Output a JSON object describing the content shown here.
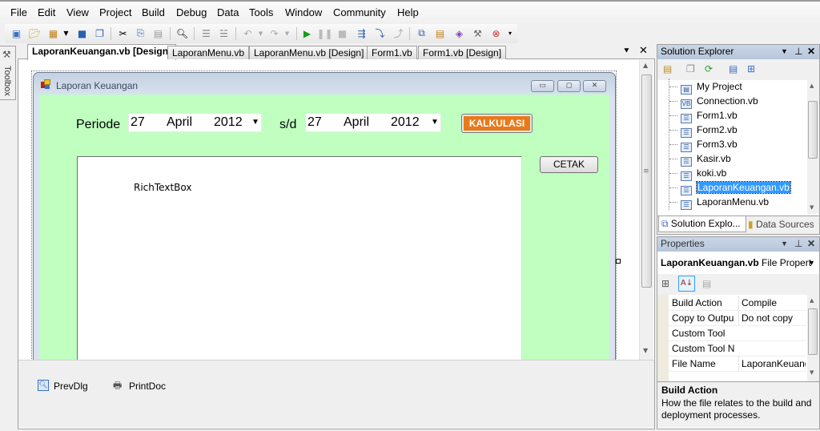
{
  "menu": [
    "File",
    "Edit",
    "View",
    "Project",
    "Build",
    "Debug",
    "Data",
    "Tools",
    "Window",
    "Community",
    "Help"
  ],
  "toolbar": {
    "icons": [
      "new-project-icon",
      "open-file-icon",
      "add-item-icon",
      "save-icon",
      "save-all-icon",
      "cut-icon",
      "copy-icon",
      "paste-icon",
      "find-icon",
      "comment-icon",
      "uncomment-icon",
      "undo-icon",
      "redo-icon",
      "start-debug-icon",
      "pause-icon",
      "stop-icon",
      "step-into-icon",
      "step-over-icon",
      "step-out-icon",
      "solution-explorer-icon",
      "properties-icon",
      "object-browser-icon",
      "toolbox-icon",
      "error-list-icon"
    ]
  },
  "toolbox": {
    "label": "Toolbox"
  },
  "tabs": [
    {
      "label": "LaporanKeuangan.vb [Design]",
      "active": true
    },
    {
      "label": "LaporanMenu.vb",
      "active": false
    },
    {
      "label": "LaporanMenu.vb [Design]",
      "active": false
    },
    {
      "label": "Form1.vb",
      "active": false
    },
    {
      "label": "Form1.vb [Design]",
      "active": false
    }
  ],
  "form": {
    "title": "Laporan Keuangan",
    "periode_label": "Periode",
    "sd_label": "s/d",
    "date_from": {
      "day": "27",
      "month": "April",
      "year": "2012"
    },
    "date_to": {
      "day": "27",
      "month": "April",
      "year": "2012"
    },
    "kalkulasi_label": "KALKULASI",
    "cetak_label": "CETAK",
    "richtextbox_text": "RichTextBox",
    "accent_color": "#e87a1a",
    "back_color": "#c0ffc0"
  },
  "tray": [
    {
      "label": "PrevDlg",
      "icon": "print-preview-icon"
    },
    {
      "label": "PrintDoc",
      "icon": "print-document-icon"
    }
  ],
  "solution_explorer": {
    "title": "Solution Explorer",
    "items": [
      {
        "label": "My Project",
        "selected": false
      },
      {
        "label": "Connection.vb",
        "selected": false
      },
      {
        "label": "Form1.vb",
        "selected": false
      },
      {
        "label": "Form2.vb",
        "selected": false
      },
      {
        "label": "Form3.vb",
        "selected": false
      },
      {
        "label": "Kasir.vb",
        "selected": false
      },
      {
        "label": "koki.vb",
        "selected": false
      },
      {
        "label": "LaporanKeuangan.vb",
        "selected": true
      },
      {
        "label": "LaporanMenu.vb",
        "selected": false
      }
    ],
    "bottom_tabs": [
      "Solution Explo...",
      "Data Sources"
    ]
  },
  "properties": {
    "title": "Properties",
    "object_name": "LaporanKeuangan.vb",
    "object_type": "File Propert",
    "rows": [
      {
        "key": "Build Action",
        "value": "Compile"
      },
      {
        "key": "Copy to Outpu",
        "value": "Do not copy"
      },
      {
        "key": "Custom Tool",
        "value": ""
      },
      {
        "key": "Custom Tool N",
        "value": ""
      },
      {
        "key": "File Name",
        "value": "LaporanKeuang"
      }
    ],
    "desc_title": "Build Action",
    "desc_text": "How the file relates to the build and deployment processes."
  }
}
